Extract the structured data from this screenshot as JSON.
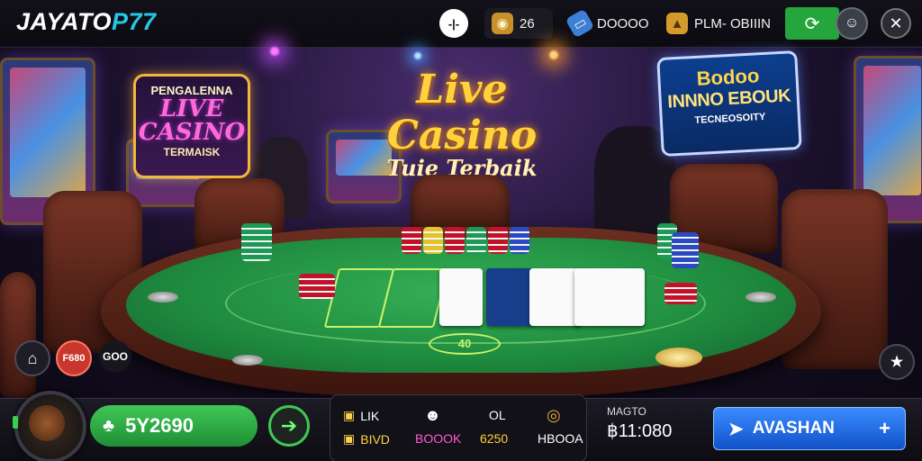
{
  "header": {
    "logo_part1": "JAYATO",
    "logo_part2": "P77",
    "stat_glyph": "-|-",
    "coins_value": "26",
    "tickets_value": "DOOOO",
    "gold_value": "PLM- OBIIIN",
    "icons": [
      "chart-icon",
      "coin-stack-icon",
      "ticket-icon",
      "gold-bag-icon",
      "refresh-icon",
      "user-icon",
      "close-icon"
    ]
  },
  "scene": {
    "left_sign": {
      "top": "PENGALENNA",
      "middle1": "LIVE",
      "middle2": "CASINO",
      "bottom": "TERMAISK"
    },
    "title_main": "Live Casino",
    "title_sub": "Tuie Terbaik",
    "right_sign": {
      "line1": "Bodoo",
      "line2": "INNNO EBOUK",
      "line3": "TECNEOSOITY"
    },
    "felt_label": "40"
  },
  "side_controls": {
    "home_icon": "home-icon",
    "badge_red": "F680",
    "badge_dark": "GOO",
    "star_icon": "star-icon"
  },
  "bottom": {
    "balance": "5Y2690",
    "stats": {
      "row1_col1": "LIK",
      "row2_col1": "BIVD",
      "row1_col3": "OL",
      "row2_col2": "BOOOK",
      "row2_col3": "6250",
      "row2_col4": "HBOOA"
    },
    "clock_label": "MAGTO",
    "clock_value": "฿11:080",
    "play_label": "AVASHAN",
    "play_plus": "+"
  },
  "colors": {
    "accent_green": "#3fc756",
    "accent_blue": "#1f6fe8",
    "logo_cyan": "#27c6e8",
    "gold": "#ffd23c"
  }
}
